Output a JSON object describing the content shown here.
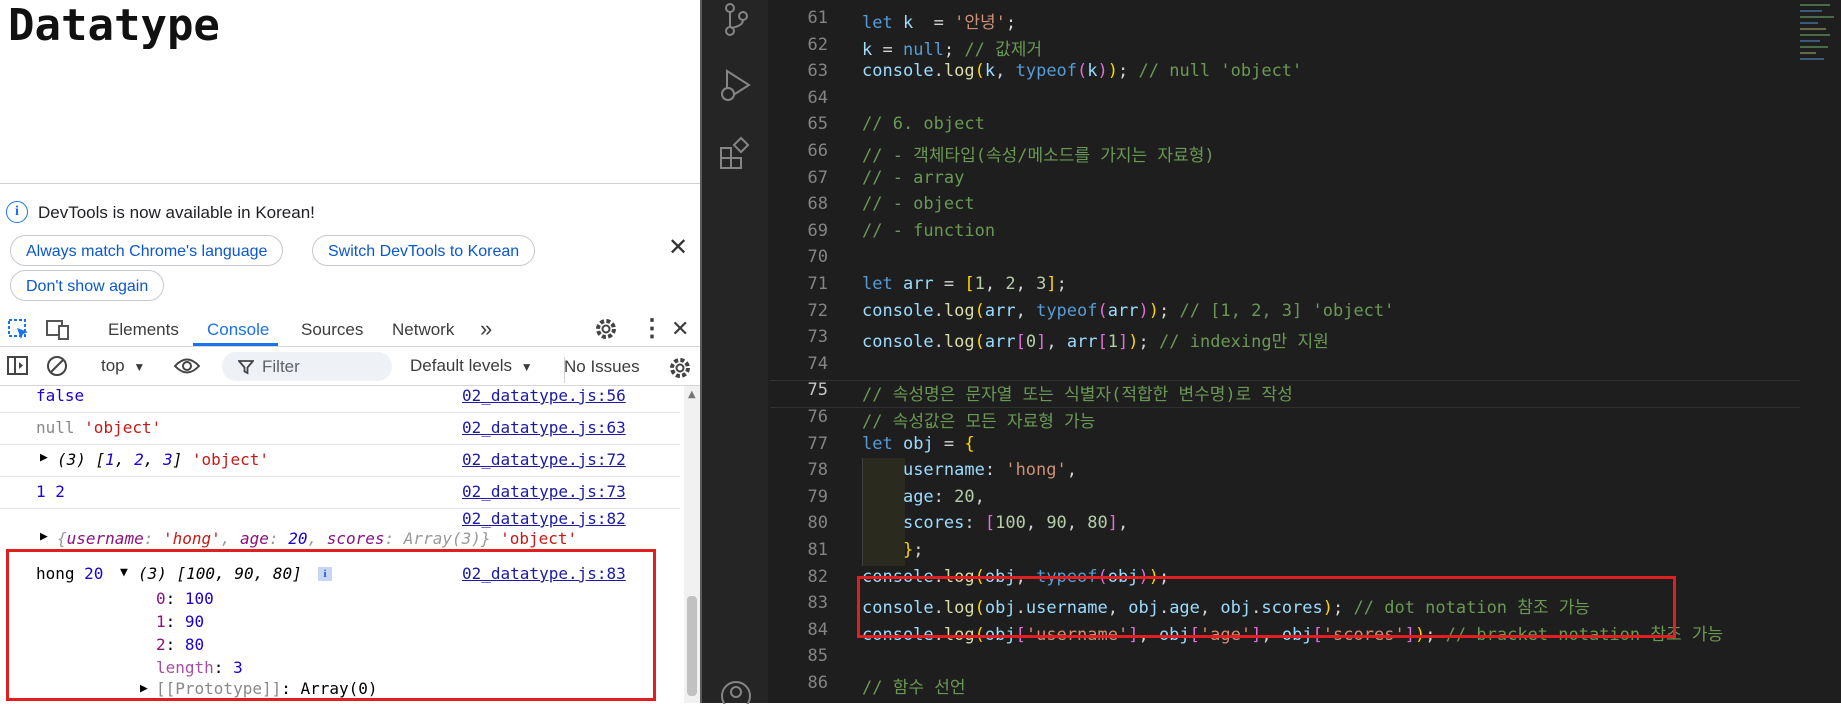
{
  "page": {
    "heading": "Datatype"
  },
  "devtools": {
    "banner": {
      "message": "DevTools is now available in Korean!",
      "buttons": [
        "Always match Chrome's language",
        "Switch DevTools to Korean",
        "Don't show again"
      ]
    },
    "tabs": [
      "Elements",
      "Console",
      "Sources",
      "Network"
    ],
    "active_tab": "Console",
    "toolbar": {
      "context": "top",
      "filter_placeholder": "Filter",
      "levels": "Default levels",
      "issues": "No Issues"
    },
    "console": {
      "row1": {
        "text": "false",
        "src": "02_datatype.js:56"
      },
      "row2": {
        "val": "null",
        "str": "'object'",
        "src": "02_datatype.js:63"
      },
      "row3": {
        "prefix": "(3) [",
        "n1": "1",
        "n2": "2",
        "n3": "3",
        "suffix": "]",
        "str": "'object'",
        "src": "02_datatype.js:72"
      },
      "row4": {
        "text": "1 2",
        "src": "02_datatype.js:73"
      },
      "row5": {
        "src": "02_datatype.js:82",
        "k1": "username",
        "v1": "'hong'",
        "k2": "age",
        "v2": "20",
        "k3": "scores",
        "v3": "Array(3)",
        "str": "'object'"
      },
      "row6": {
        "text": "hong",
        "num": "20",
        "arr": "(3) [100, 90, 80]",
        "src": "02_datatype.js:83",
        "items": [
          {
            "k": "0",
            "v": "100"
          },
          {
            "k": "1",
            "v": "90"
          },
          {
            "k": "2",
            "v": "80"
          }
        ],
        "length_key": "length",
        "length_val": "3",
        "proto": "[[Prototype]]",
        "proto_val": "Array(0)"
      }
    }
  },
  "editor": {
    "lines": [
      {
        "n": "61",
        "seg": [
          [
            "kw",
            "let "
          ],
          [
            "var",
            "k"
          ],
          [
            "",
            "  = "
          ],
          [
            "s",
            "'안녕'"
          ],
          [
            "",
            ";"
          ]
        ]
      },
      {
        "n": "62",
        "seg": [
          [
            "var",
            "k"
          ],
          [
            "",
            " = "
          ],
          [
            "kw",
            "null"
          ],
          [
            "",
            ";"
          ],
          [
            "c",
            " // 값제거"
          ]
        ]
      },
      {
        "n": "63",
        "seg": [
          [
            "var",
            "console"
          ],
          [
            "",
            "."
          ],
          [
            "fn",
            "log"
          ],
          [
            "br1",
            "("
          ],
          [
            "var",
            "k"
          ],
          [
            "",
            ", "
          ],
          [
            "kw",
            "typeof"
          ],
          [
            "br2",
            "("
          ],
          [
            "var",
            "k"
          ],
          [
            "br2",
            ")"
          ],
          [
            "br1",
            ")"
          ],
          [
            "",
            ";"
          ],
          [
            "c",
            " // null 'object'"
          ]
        ]
      },
      {
        "n": "64",
        "seg": []
      },
      {
        "n": "65",
        "seg": [
          [
            "c",
            "// 6. object"
          ]
        ]
      },
      {
        "n": "66",
        "seg": [
          [
            "c",
            "// - 객체타입(속성/메소드를 가지는 자료형)"
          ]
        ]
      },
      {
        "n": "67",
        "seg": [
          [
            "c",
            "// - array"
          ]
        ]
      },
      {
        "n": "68",
        "seg": [
          [
            "c",
            "// - object"
          ]
        ]
      },
      {
        "n": "69",
        "seg": [
          [
            "c",
            "// - function"
          ]
        ]
      },
      {
        "n": "70",
        "seg": []
      },
      {
        "n": "71",
        "seg": [
          [
            "kw",
            "let "
          ],
          [
            "var",
            "arr"
          ],
          [
            "",
            " = "
          ],
          [
            "br1",
            "["
          ],
          [
            "n",
            "1"
          ],
          [
            "",
            ", "
          ],
          [
            "n",
            "2"
          ],
          [
            "",
            ", "
          ],
          [
            "n",
            "3"
          ],
          [
            "br1",
            "]"
          ],
          [
            "",
            ";"
          ]
        ]
      },
      {
        "n": "72",
        "seg": [
          [
            "var",
            "console"
          ],
          [
            "",
            "."
          ],
          [
            "fn",
            "log"
          ],
          [
            "br1",
            "("
          ],
          [
            "var",
            "arr"
          ],
          [
            "",
            ", "
          ],
          [
            "kw",
            "typeof"
          ],
          [
            "br2",
            "("
          ],
          [
            "var",
            "arr"
          ],
          [
            "br2",
            ")"
          ],
          [
            "br1",
            ")"
          ],
          [
            "",
            ";"
          ],
          [
            "c",
            " // [1, 2, 3] 'object'"
          ]
        ]
      },
      {
        "n": "73",
        "seg": [
          [
            "var",
            "console"
          ],
          [
            "",
            "."
          ],
          [
            "fn",
            "log"
          ],
          [
            "br1",
            "("
          ],
          [
            "var",
            "arr"
          ],
          [
            "br2",
            "["
          ],
          [
            "n",
            "0"
          ],
          [
            "br2",
            "]"
          ],
          [
            "",
            ", "
          ],
          [
            "var",
            "arr"
          ],
          [
            "br2",
            "["
          ],
          [
            "n",
            "1"
          ],
          [
            "br2",
            "]"
          ],
          [
            "br1",
            ")"
          ],
          [
            "",
            ";"
          ],
          [
            "c",
            " // indexing만 지원"
          ]
        ]
      },
      {
        "n": "74",
        "seg": []
      },
      {
        "n": "75",
        "seg": [
          [
            "c",
            "// 속성명은 문자열 또는 식별자(적합한 변수명)로 작성"
          ]
        ]
      },
      {
        "n": "76",
        "seg": [
          [
            "c",
            "// 속성값은 모든 자료형 가능"
          ]
        ]
      },
      {
        "n": "77",
        "seg": [
          [
            "kw",
            "let "
          ],
          [
            "var",
            "obj"
          ],
          [
            "",
            " = "
          ],
          [
            "br1",
            "{"
          ]
        ]
      },
      {
        "n": "78",
        "seg": [
          [
            "",
            "    "
          ],
          [
            "var",
            "username"
          ],
          [
            "",
            ": "
          ],
          [
            "s",
            "'hong'"
          ],
          [
            "",
            ","
          ]
        ]
      },
      {
        "n": "79",
        "seg": [
          [
            "",
            "    "
          ],
          [
            "var",
            "age"
          ],
          [
            "",
            ": "
          ],
          [
            "n",
            "20"
          ],
          [
            "",
            ","
          ]
        ]
      },
      {
        "n": "80",
        "seg": [
          [
            "",
            "    "
          ],
          [
            "var",
            "scores"
          ],
          [
            "",
            ": "
          ],
          [
            "br2",
            "["
          ],
          [
            "n",
            "100"
          ],
          [
            "",
            ", "
          ],
          [
            "n",
            "90"
          ],
          [
            "",
            ", "
          ],
          [
            "n",
            "80"
          ],
          [
            "br2",
            "]"
          ],
          [
            "",
            ","
          ]
        ]
      },
      {
        "n": "81",
        "seg": [
          [
            "",
            "    "
          ],
          [
            "br1",
            "}"
          ],
          [
            "",
            ";"
          ]
        ]
      },
      {
        "n": "82",
        "seg": [
          [
            "var",
            "console"
          ],
          [
            "",
            "."
          ],
          [
            "fn",
            "log"
          ],
          [
            "br1",
            "("
          ],
          [
            "var",
            "obj"
          ],
          [
            "",
            ", "
          ],
          [
            "kw",
            "typeof"
          ],
          [
            "br2",
            "("
          ],
          [
            "var",
            "obj"
          ],
          [
            "br2",
            ")"
          ],
          [
            "br1",
            ")"
          ],
          [
            "",
            ";"
          ]
        ]
      },
      {
        "n": "83",
        "seg": [
          [
            "var",
            "console"
          ],
          [
            "",
            "."
          ],
          [
            "fn",
            "log"
          ],
          [
            "br1",
            "("
          ],
          [
            "var",
            "obj"
          ],
          [
            "",
            "."
          ],
          [
            "var",
            "username"
          ],
          [
            "",
            ", "
          ],
          [
            "var",
            "obj"
          ],
          [
            "",
            "."
          ],
          [
            "var",
            "age"
          ],
          [
            "",
            ", "
          ],
          [
            "var",
            "obj"
          ],
          [
            "",
            "."
          ],
          [
            "var",
            "scores"
          ],
          [
            "br1",
            ")"
          ],
          [
            "",
            ";"
          ],
          [
            "c",
            " // dot notation 참조 가능"
          ]
        ]
      },
      {
        "n": "84",
        "seg": [
          [
            "var",
            "console"
          ],
          [
            "",
            "."
          ],
          [
            "fn",
            "log"
          ],
          [
            "br1",
            "("
          ],
          [
            "var",
            "obj"
          ],
          [
            "br2",
            "["
          ],
          [
            "s",
            "'username'"
          ],
          [
            "br2",
            "]"
          ],
          [
            "",
            ", "
          ],
          [
            "var",
            "obj"
          ],
          [
            "br2",
            "["
          ],
          [
            "s",
            "'age'"
          ],
          [
            "br2",
            "]"
          ],
          [
            "",
            ", "
          ],
          [
            "var",
            "obj"
          ],
          [
            "br2",
            "["
          ],
          [
            "s",
            "'scores'"
          ],
          [
            "br2",
            "]"
          ],
          [
            "br1",
            ")"
          ],
          [
            "",
            ";"
          ],
          [
            "c",
            " // bracket notation 참조 가능"
          ]
        ]
      },
      {
        "n": "85",
        "seg": []
      },
      {
        "n": "86",
        "seg": [
          [
            "c",
            "// 함수 선언"
          ]
        ]
      }
    ]
  }
}
